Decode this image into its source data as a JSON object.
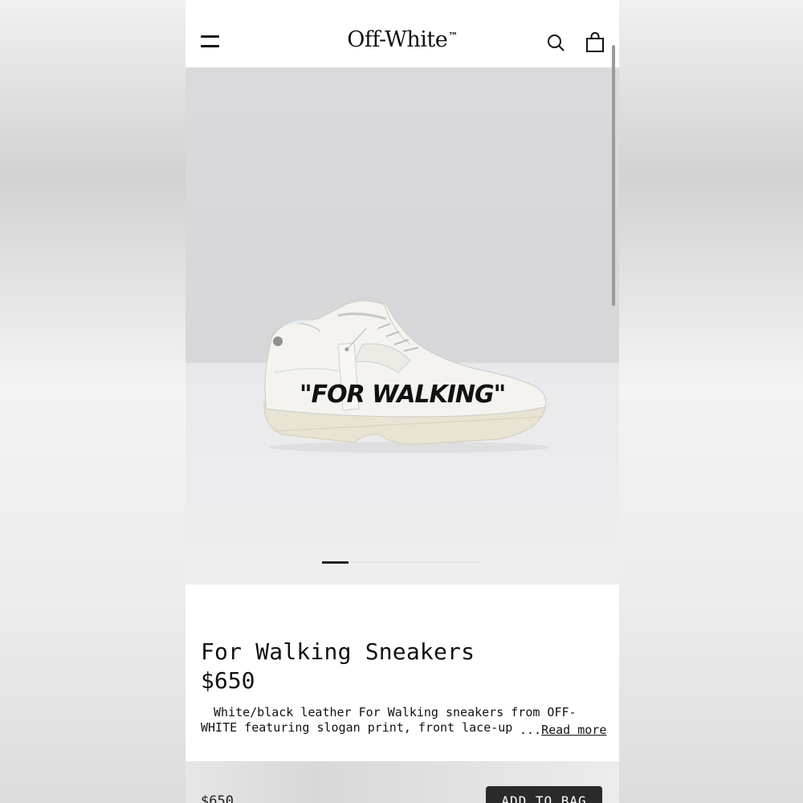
{
  "header": {
    "brand": "Off-White",
    "brand_mark": "™"
  },
  "product": {
    "shoe_print": "\"FOR WALKING\"",
    "title": "For Walking Sneakers",
    "price": "$650",
    "description": "White/black leather For Walking sneakers from OFF-WHITE featuring slogan print, front lace-up",
    "ellipsis": "...",
    "read_more": "Read more"
  },
  "gallery": {
    "current_slide": 1
  },
  "bottom_bar": {
    "price": "$650",
    "add_to_bag": "ADD TO BAG"
  },
  "icons": {
    "menu": "menu-icon",
    "search": "search-icon",
    "bag": "shopping-bag-icon"
  }
}
